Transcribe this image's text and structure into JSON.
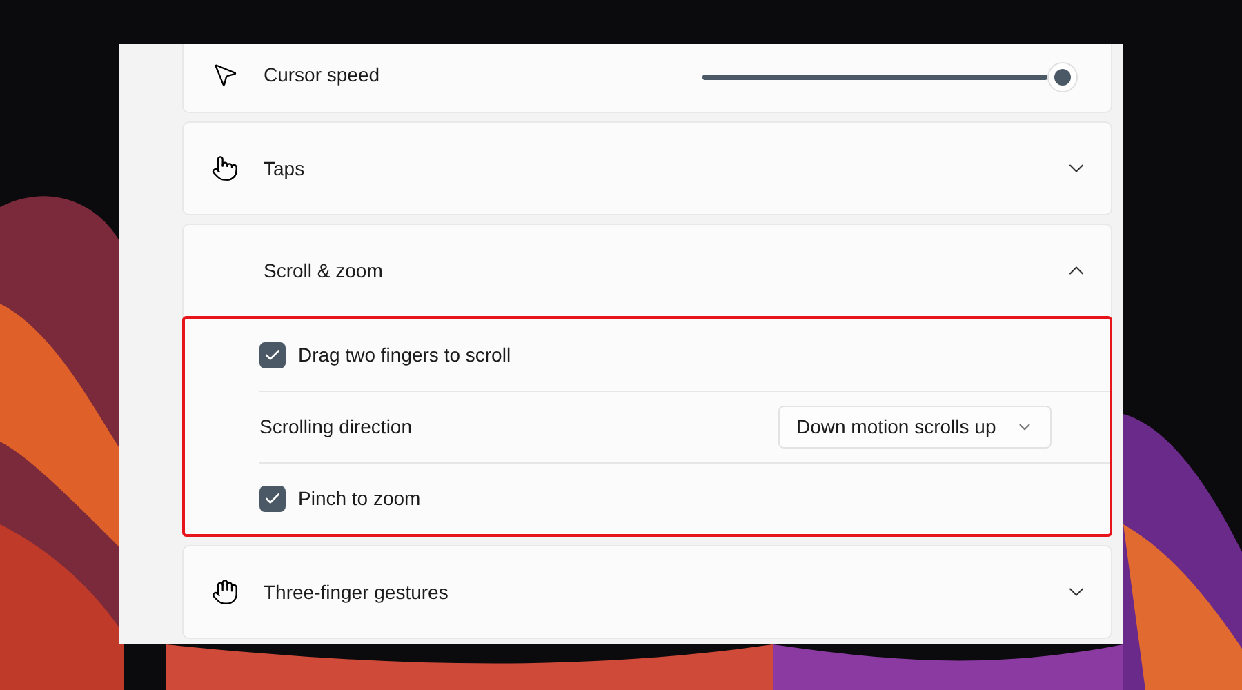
{
  "settings": [
    {
      "kind": "slider",
      "label": "Cursor speed",
      "level": 1
    },
    {
      "kind": "expander",
      "label": "Taps",
      "expanded": false
    },
    {
      "kind": "expander",
      "label": "Scroll & zoom",
      "expanded": true,
      "highlighted": true,
      "children": [
        {
          "kind": "checkbox",
          "label": "Drag two fingers to scroll",
          "checked": true
        },
        {
          "kind": "dropdown",
          "label": "Scrolling direction",
          "value": "Down motion scrolls up"
        },
        {
          "kind": "checkbox",
          "label": "Pinch to zoom",
          "checked": true
        }
      ]
    },
    {
      "kind": "expander",
      "label": "Three-finger gestures",
      "expanded": false
    }
  ]
}
